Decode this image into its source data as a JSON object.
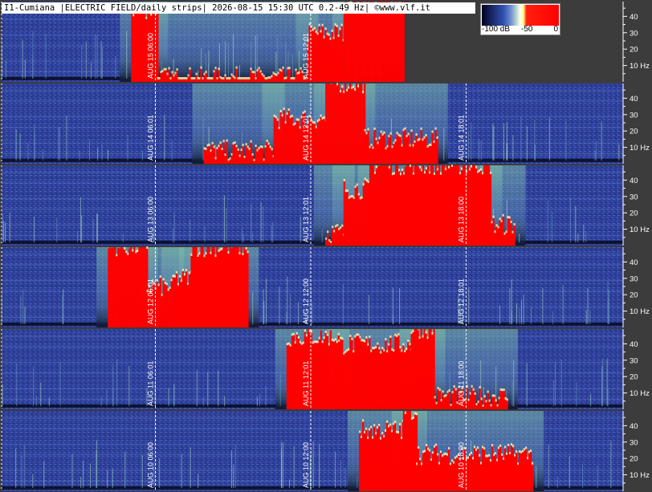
{
  "title": "I1-Cumiana |ELECTRIC FIELD/daily strips| 2026-08-15 15:30 UTC 0.2-49 Hz| ©www.vlf.it",
  "colors": {
    "background": "#3c3c3c",
    "spectrum_low": "#2c3e96",
    "spectrum_high": "#ff0000",
    "noise_band": "#9ed3b0"
  },
  "color_scale": {
    "labels": [
      "-100 dB",
      "-50",
      "0"
    ]
  },
  "chart_data": {
    "type": "heatmap",
    "description_units": "frequency Hz vs time UTC, daily spectrogram strips",
    "freq_ticks": [
      "40",
      "30",
      "20",
      "10 Hz"
    ],
    "freq_tick_values": [
      40,
      30,
      20,
      10
    ],
    "ylim": [
      0,
      49
    ],
    "strips": [
      {
        "date_label": "AUG 15",
        "time_marks": [
          {
            "hour": 6,
            "label": "AUG 15  06:00"
          },
          {
            "hour": 12,
            "label": "AUG 15  12:01"
          }
        ],
        "data_end_hour": 15.5,
        "red_regions": [
          [
            5.0,
            15.5
          ]
        ],
        "red_profile": [
          [
            5.0,
            6.0,
            0.9
          ],
          [
            6.0,
            11.8,
            0.04
          ],
          [
            11.8,
            13.2,
            0.6
          ],
          [
            13.2,
            15.5,
            1.0
          ]
        ]
      },
      {
        "date_label": "AUG 14",
        "time_marks": [
          {
            "hour": 6,
            "label": "AUG 14  06:01"
          },
          {
            "hour": 12,
            "label": "AUG 14  12:01"
          },
          {
            "hour": 18,
            "label": "AUG 14  18:01"
          }
        ],
        "data_end_hour": 24,
        "red_profile": [
          [
            7.8,
            10.5,
            0.15
          ],
          [
            10.5,
            12.5,
            0.55
          ],
          [
            12.5,
            14.0,
            1.0
          ],
          [
            14.0,
            16.8,
            0.3
          ]
        ]
      },
      {
        "date_label": "AUG 13",
        "time_marks": [
          {
            "hour": 6,
            "label": "AUG 13  06:00"
          },
          {
            "hour": 12,
            "label": "AUG 13  12:01"
          },
          {
            "hour": 18,
            "label": "AUG 13  18:00"
          }
        ],
        "data_end_hour": 24,
        "red_profile": [
          [
            12.5,
            13.2,
            0.15
          ],
          [
            13.2,
            14.2,
            0.7
          ],
          [
            14.2,
            18.9,
            1.0
          ],
          [
            18.9,
            19.8,
            0.25
          ]
        ]
      },
      {
        "date_label": "AUG 12",
        "time_marks": [
          {
            "hour": 6,
            "label": "AUG 12  06:01"
          },
          {
            "hour": 12,
            "label": "AUG 12  12:00"
          },
          {
            "hour": 18,
            "label": "AUG 12  18:01"
          }
        ],
        "data_end_hour": 24,
        "red_profile": [
          [
            4.1,
            5.6,
            1.0
          ],
          [
            5.6,
            6.6,
            0.5
          ],
          [
            6.6,
            7.3,
            0.6
          ],
          [
            7.3,
            9.5,
            1.0
          ]
        ]
      },
      {
        "date_label": "AUG 11",
        "time_marks": [
          {
            "hour": 6,
            "label": "AUG 11  06:01"
          },
          {
            "hour": 12,
            "label": "AUG 11  12:01"
          },
          {
            "hour": 18,
            "label": "AUG 11  18:00"
          }
        ],
        "data_end_hour": 24,
        "red_profile": [
          [
            11.0,
            13.0,
            0.9
          ],
          [
            13.0,
            15.8,
            0.8
          ],
          [
            15.8,
            16.7,
            1.0
          ],
          [
            16.7,
            19.5,
            0.15
          ]
        ]
      },
      {
        "date_label": "AUG 10",
        "time_marks": [
          {
            "hour": 6,
            "label": "AUG 10  06:00"
          },
          {
            "hour": 12,
            "label": "AUG 10  12:00"
          },
          {
            "hour": 18,
            "label": "AUG 10  18:00"
          }
        ],
        "data_end_hour": 24,
        "red_profile": [
          [
            13.8,
            15.5,
            0.75
          ],
          [
            15.5,
            16.0,
            1.0
          ],
          [
            16.0,
            20.5,
            0.45
          ]
        ]
      }
    ]
  }
}
